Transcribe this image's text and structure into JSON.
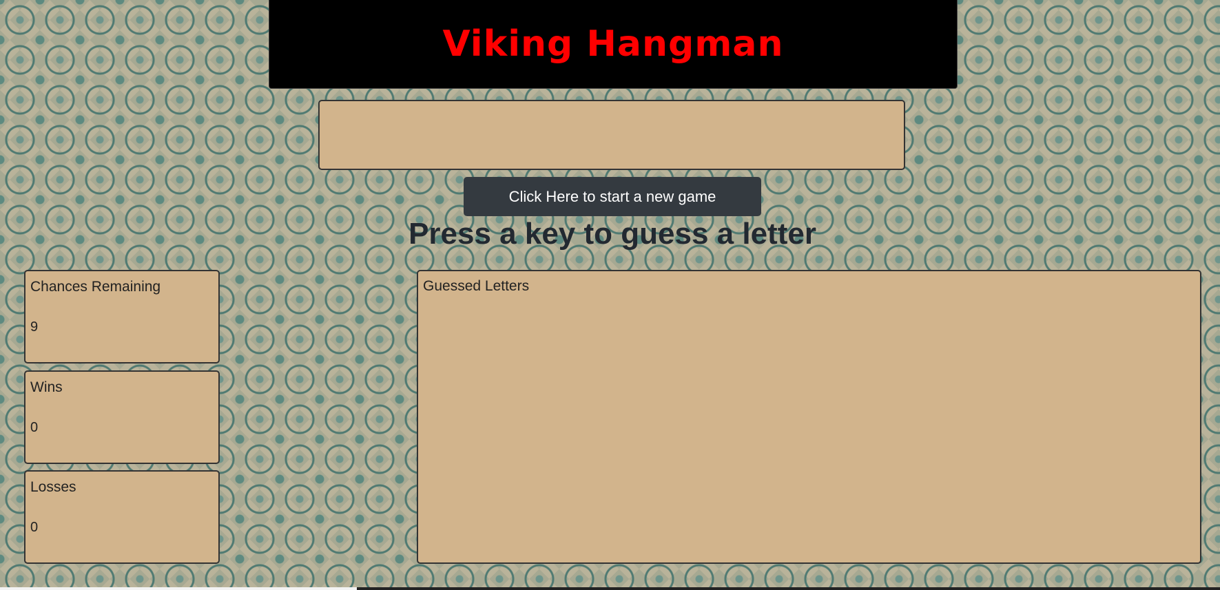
{
  "header": {
    "title": "Viking Hangman"
  },
  "game": {
    "current_word": "",
    "new_game_label": "Click Here to start a new game",
    "prompt": "Press a key to guess a letter"
  },
  "stats": {
    "chances": {
      "label": "Chances Remaining",
      "value": "9"
    },
    "wins": {
      "label": "Wins",
      "value": "0"
    },
    "losses": {
      "label": "Losses",
      "value": "0"
    }
  },
  "guessed": {
    "label": "Guessed Letters",
    "letters": ""
  },
  "colors": {
    "title": "#ff0000",
    "header_bg": "#000000",
    "panel_bg": "#d2b48c",
    "button_bg": "#343a40"
  }
}
